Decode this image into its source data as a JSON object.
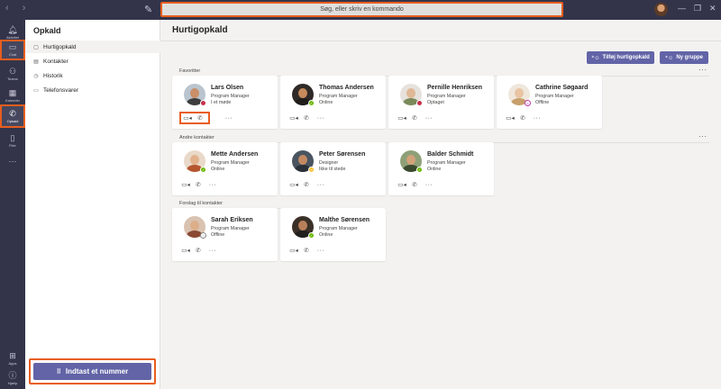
{
  "search": {
    "placeholder": "Søg, eller skriv en kommando"
  },
  "rail": [
    {
      "label": "Aktivitet",
      "icon": "bell-icon"
    },
    {
      "label": "Chat",
      "icon": "chat-icon"
    },
    {
      "label": "Teams",
      "icon": "teams-icon"
    },
    {
      "label": "Kalender",
      "icon": "calendar-icon"
    },
    {
      "label": "Opkald",
      "icon": "phone-icon"
    },
    {
      "label": "Filer",
      "icon": "file-icon"
    },
    {
      "label": "Apps",
      "icon": "apps-icon"
    },
    {
      "label": "Hjælp",
      "icon": "help-icon"
    }
  ],
  "sidebar": {
    "title": "Opkald",
    "items": [
      {
        "label": "Hurtigopkald",
        "icon": "speed-dial-icon"
      },
      {
        "label": "Kontakter",
        "icon": "contacts-icon"
      },
      {
        "label": "Historik",
        "icon": "history-icon"
      },
      {
        "label": "Telefonsvarer",
        "icon": "voicemail-icon"
      }
    ],
    "dial_button": "Indtast et nummer"
  },
  "main": {
    "title": "Hurtigopkald",
    "add_speed_dial": "Tilføj hurtigopkald",
    "new_group": "Ny gruppe",
    "sections": [
      {
        "label": "Favoritter",
        "contacts": [
          {
            "name": "Lars Olsen",
            "role": "Program Manager",
            "status": "I et møde",
            "presence": "busy",
            "presence_color": "#c4314b"
          },
          {
            "name": "Thomas Andersen",
            "role": "Program Manager",
            "status": "Online",
            "presence": "available",
            "presence_color": "#6bb700"
          },
          {
            "name": "Pernille Henriksen",
            "role": "Program Manager",
            "status": "Optaget",
            "presence": "busy",
            "presence_color": "#c4314b"
          },
          {
            "name": "Cathrine Søgaard",
            "role": "Program Manager",
            "status": "Offline",
            "presence": "offline",
            "presence_color": "#c239b3"
          }
        ]
      },
      {
        "label": "Andre kontakter",
        "contacts": [
          {
            "name": "Mette Andersen",
            "role": "Program Manager",
            "status": "Online",
            "presence": "available",
            "presence_color": "#6bb700"
          },
          {
            "name": "Peter Sørensen",
            "role": "Designer",
            "status": "Ikke til stede",
            "presence": "away",
            "presence_color": "#fdb913"
          },
          {
            "name": "Balder Schmidt",
            "role": "Program Manager",
            "status": "Online",
            "presence": "available",
            "presence_color": "#6bb700"
          }
        ]
      },
      {
        "label": "Forslag til kontakter",
        "contacts": [
          {
            "name": "Sarah Eriksen",
            "role": "Program Manager",
            "status": "Offline",
            "presence": "offline",
            "presence_color": "#ffffff"
          },
          {
            "name": "Malthe Sørensen",
            "role": "Program Manager",
            "status": "Online",
            "presence": "available",
            "presence_color": "#6bb700"
          }
        ]
      }
    ]
  },
  "colors": {
    "accent": "#6264a7",
    "highlight": "#e85d1e",
    "rail_bg": "#33344a"
  }
}
